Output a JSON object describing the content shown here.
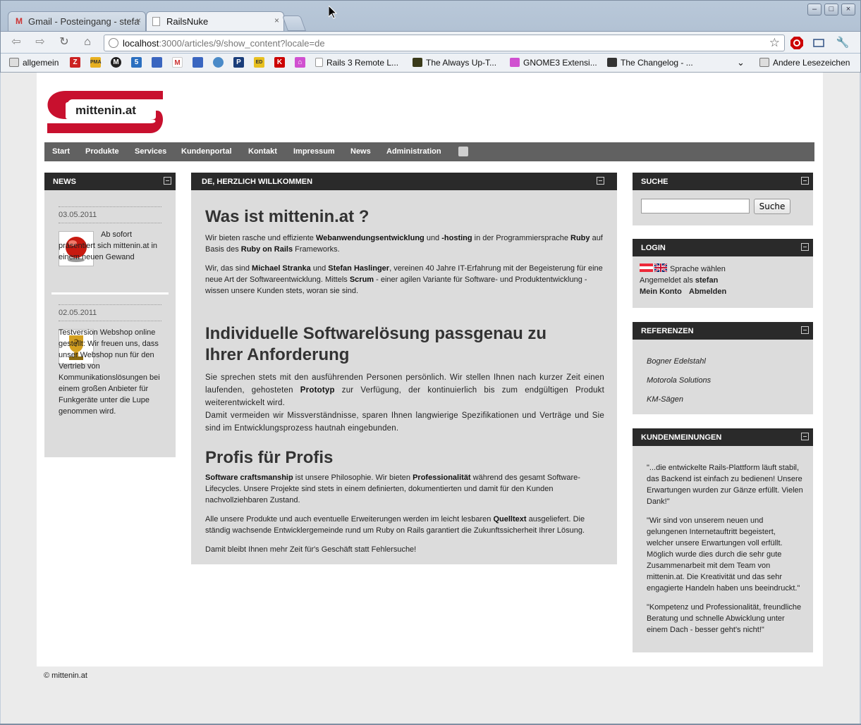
{
  "browser": {
    "tabs": [
      {
        "title": "Gmail - Posteingang - stefa",
        "close": "×"
      },
      {
        "title": "RailsNuke",
        "close": "×"
      }
    ],
    "url_host": "localhost",
    "url_rest": ":3000/articles/9/show_content?locale=de",
    "window_controls": [
      "–",
      "□",
      "×"
    ],
    "bookmarks": [
      {
        "label": "allgemein"
      },
      {
        "label": "Rails 3 Remote L..."
      },
      {
        "label": "The Always Up-T..."
      },
      {
        "label": "GNOME3 Extensi..."
      },
      {
        "label": "The Changelog - ..."
      },
      {
        "label": "Andere Lesezeichen"
      }
    ]
  },
  "site": {
    "logo_text": "mittenin.at",
    "nav": [
      "Start",
      "Produkte",
      "Services",
      "Kundenportal",
      "Kontakt",
      "Impressum",
      "News",
      "Administration"
    ],
    "footer": "© mittenin.at"
  },
  "news": {
    "title": "NEWS",
    "items": [
      {
        "date": "03.05.2011",
        "text": "Ab sofort präsentiert sich mittenin.at in einem neuen Gewand"
      },
      {
        "date": "02.05.2011",
        "text": "Testversion Webshop online gestellt: Wir freuen uns, dass unser Webshop nun für den Vertrieb von Kommunikationslösungen bei einem großen Anbieter für Funkgeräte unter die Lupe genommen wird."
      }
    ]
  },
  "main": {
    "title": "DE, HERZLICH WILLKOMMEN",
    "h1": "Was ist mittenin.at ?",
    "p1": [
      {
        "t": "Wir bieten rasche und effiziente "
      },
      {
        "b": "Webanwendungsentwicklung"
      },
      {
        "t": " und "
      },
      {
        "b": "-hosting"
      },
      {
        "t": " in der Programmiersprache "
      },
      {
        "b": "Ruby"
      },
      {
        "t": " auf Basis des "
      },
      {
        "b": "Ruby on Rails"
      },
      {
        "t": " Frameworks."
      }
    ],
    "p2": [
      {
        "t": "Wir, das sind "
      },
      {
        "b": "Michael Stranka"
      },
      {
        "t": " und "
      },
      {
        "b": "Stefan Haslinger"
      },
      {
        "t": ", vereinen 40 Jahre IT-Erfahrung mit der Begeisterung für eine neue Art der Softwareentwicklung. Mittels "
      },
      {
        "b": "Scrum"
      },
      {
        "t": " - einer agilen Variante für Software- und Produktentwicklung - wissen unsere Kunden stets, woran sie sind."
      }
    ],
    "h2": "Individuelle Softwarelösung passgenau zu Ihrer Anforderung",
    "p3": [
      {
        "t": "Sie sprechen stets mit den ausführenden Personen persönlich. Wir stellen Ihnen nach kurzer Zeit einen laufenden, gehosteten "
      },
      {
        "b": "Prototyp"
      },
      {
        "t": " zur Verfügung, der kontinuierlich bis zum endgültigen Produkt weiterentwickelt wird."
      }
    ],
    "p4": "Damit vermeiden wir Missverständnisse, sparen Ihnen langwierige Spezifikationen und Verträge und Sie sind im Entwicklungsprozess hautnah eingebunden.",
    "h3": "Profis für Profis",
    "p5": [
      {
        "b": "Software craftsmanship"
      },
      {
        "t": " ist unsere Philosophie. Wir bieten "
      },
      {
        "b": "Professionalität"
      },
      {
        "t": " während des gesamt Software-Lifecycles. Unsere Projekte sind stets in einem definierten, dokumentierten und damit für den Kunden nachvollziehbaren Zustand."
      }
    ],
    "p6": [
      {
        "t": "Alle unsere Produkte und auch eventuelle Erweiterungen werden im leicht lesbaren "
      },
      {
        "b": "Quelltext"
      },
      {
        "t": " ausgeliefert. Die ständig wachsende Entwicklergemeinde rund um Ruby on Rails garantiert die Zukunftssicherheit Ihrer Lösung."
      }
    ],
    "p7": "Damit bleibt Ihnen mehr Zeit für's Geschäft statt Fehlersuche!"
  },
  "search": {
    "title": "SUCHE",
    "button": "Suche",
    "placeholder": ""
  },
  "login": {
    "title": "LOGIN",
    "language": "Sprache wählen",
    "logged_in_prefix": "Angemeldet als ",
    "user": "stefan",
    "my_account": "Mein Konto",
    "logout": "Abmelden"
  },
  "references": {
    "title": "REFERENZEN",
    "items": [
      "Bogner Edelstahl",
      "Motorola Solutions",
      "KM-Sägen"
    ]
  },
  "testimonials": {
    "title": "KUNDENMEINUNGEN",
    "items": [
      "\"...die entwickelte Rails-Plattform läuft stabil, das Backend ist einfach zu bedienen! Unsere Erwartungen wurden zur Gänze erfüllt. Vielen Dank!\"",
      "\"Wir sind von unserem neuen und gelungenen Internetauftritt begeistert, welcher unsere Erwartungen voll erfüllt. Möglich wurde dies durch die sehr gute Zusammenarbeit mit dem Team von mittenin.at. Die Kreativität und das sehr engagierte Handeln haben uns beeindruckt.\"",
      "\"Kompetenz und Professionalität, freundliche Beratung und schnelle Abwicklung unter einem Dach - besser geht's nicht!\""
    ]
  }
}
